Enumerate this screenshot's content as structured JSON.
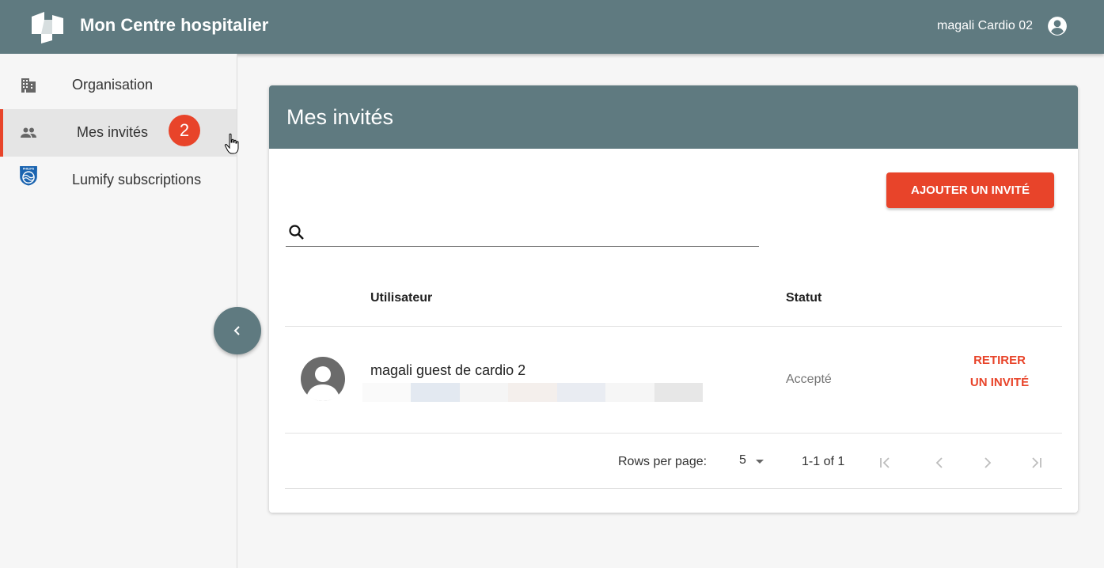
{
  "header": {
    "app_title": "Mon Centre hospitalier",
    "user_name": "magali Cardio 02",
    "logo_icon": "hospital-logo-icon",
    "user_icon": "account-circle-icon"
  },
  "sidebar": {
    "items": [
      {
        "label": "Organisation",
        "icon": "building-icon",
        "active": false
      },
      {
        "label": "Mes invités",
        "icon": "people-icon",
        "active": true
      },
      {
        "label": "Lumify subscriptions",
        "icon": "philips-shield-icon",
        "active": false
      }
    ],
    "badge": "2",
    "collapse_icon": "chevron-left-icon"
  },
  "main": {
    "title": "Mes invités",
    "add_button": "AJOUTER UN INVITÉ",
    "search": {
      "value": "",
      "placeholder": "",
      "icon": "search-icon"
    },
    "table": {
      "columns": [
        "Utilisateur",
        "Statut"
      ],
      "rows": [
        {
          "name": "magali guest de cardio 2",
          "status": "Accepté",
          "action": "RETIRER UN INVITÉ",
          "avatar": "person-avatar-icon"
        }
      ]
    },
    "pagination": {
      "rows_per_page_label": "Rows per page:",
      "rows_per_page": "5",
      "range": "1-1 of 1",
      "icons": [
        "first-page-icon",
        "previous-page-icon",
        "next-page-icon",
        "last-page-icon"
      ]
    }
  },
  "colors": {
    "header": "#5f7a80",
    "accent": "#e8442a",
    "background": "#f6f6f6"
  }
}
